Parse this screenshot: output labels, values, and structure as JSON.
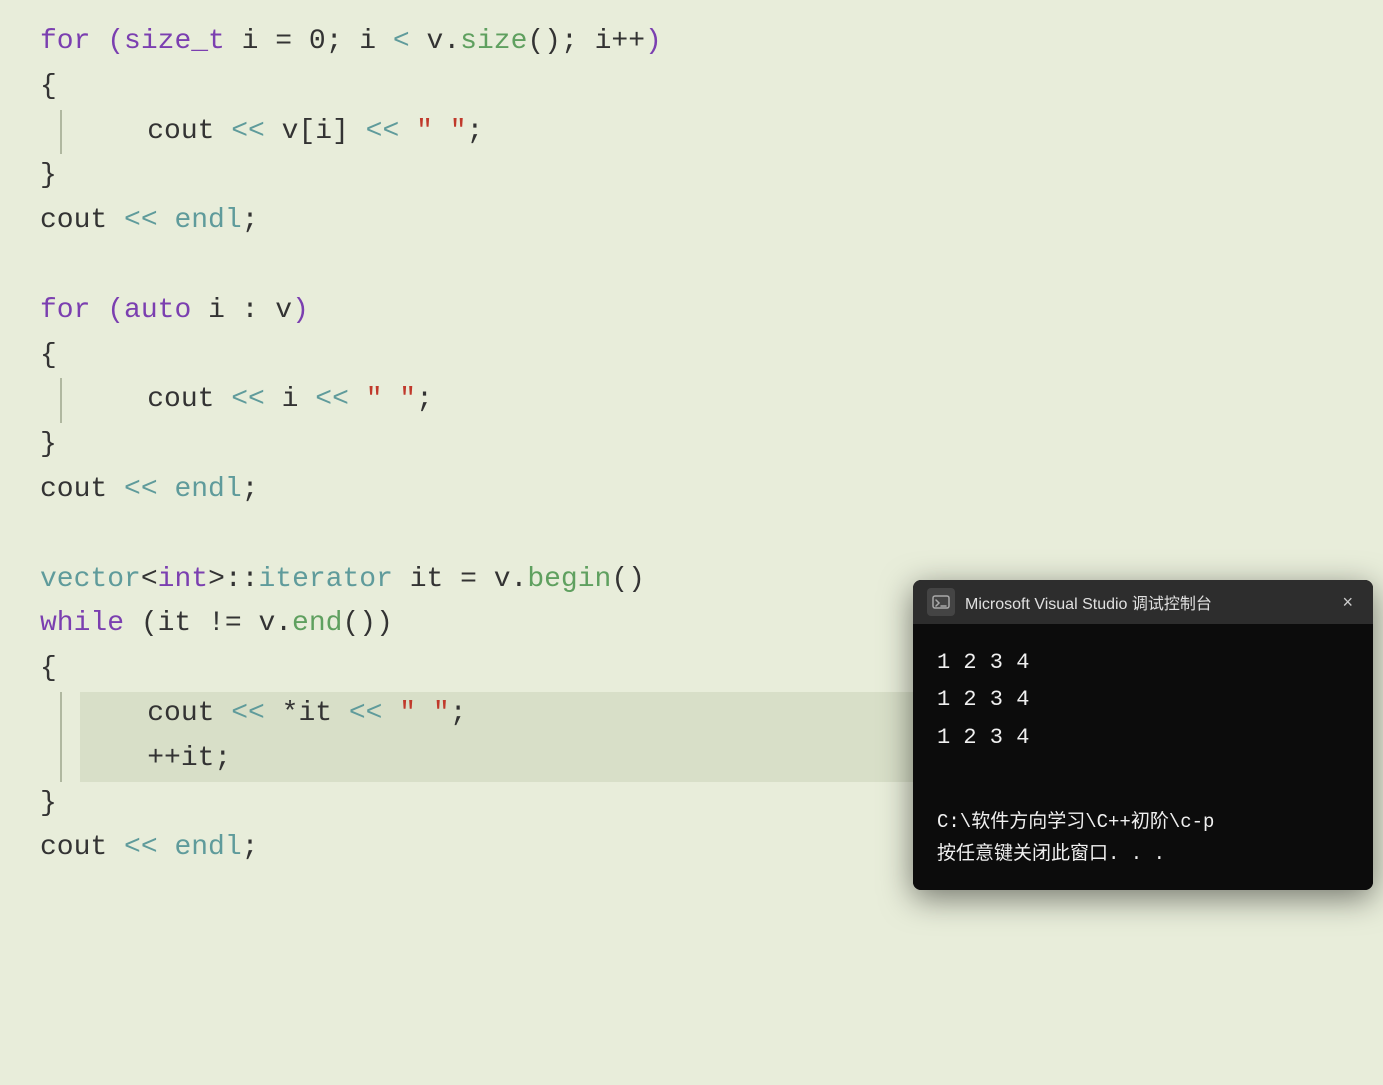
{
  "editor": {
    "bg": "#e8edda",
    "lines": [
      {
        "id": "l1",
        "content": "for (size_t i = 0; i < v.size(); i++)"
      },
      {
        "id": "l2",
        "content": "{"
      },
      {
        "id": "l3",
        "content": "    cout << v[i] << \" \";"
      },
      {
        "id": "l4",
        "content": "}"
      },
      {
        "id": "l5",
        "content": "cout << endl;"
      },
      {
        "id": "l6",
        "content": ""
      },
      {
        "id": "l7",
        "content": "for (auto i : v)"
      },
      {
        "id": "l8",
        "content": "{"
      },
      {
        "id": "l9",
        "content": "    cout << i << \" \";"
      },
      {
        "id": "l10",
        "content": "}"
      },
      {
        "id": "l11",
        "content": "cout << endl;"
      },
      {
        "id": "l12",
        "content": ""
      },
      {
        "id": "l13",
        "content": "vector<int>::iterator it = v.begin()"
      },
      {
        "id": "l14",
        "content": "while (it != v.end())"
      },
      {
        "id": "l15",
        "content": "{"
      },
      {
        "id": "l16",
        "content": "    cout << *it << \" \";",
        "highlighted": true
      },
      {
        "id": "l17",
        "content": "    ++it;",
        "highlighted": true
      },
      {
        "id": "l18",
        "content": "}"
      },
      {
        "id": "l19",
        "content": "cout << endl;"
      }
    ]
  },
  "terminal": {
    "title": "Microsoft Visual Studio 调试控制台",
    "close_label": "×",
    "output_lines": [
      "1 2 3 4",
      "1 2 3 4",
      "1 2 3 4"
    ],
    "path_line": "C:\\软件方向学习\\C++初阶\\c-p",
    "prompt_line": "按任意键关闭此窗口. . ."
  }
}
